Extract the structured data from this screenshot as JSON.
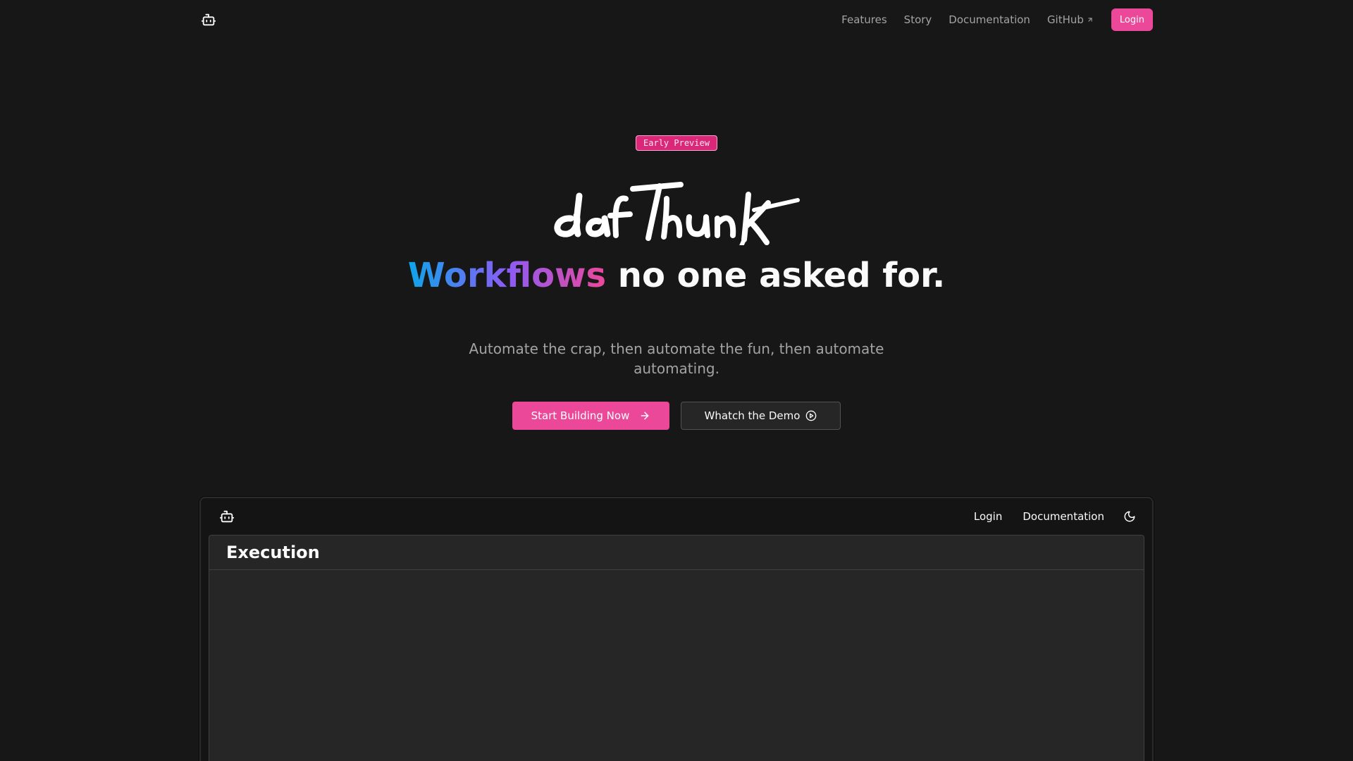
{
  "nav": {
    "logo_icon": "bot-icon",
    "links": [
      "Features",
      "Story",
      "Documentation",
      "GitHub"
    ],
    "github_icon": "arrow-up-right-icon",
    "login_label": "Login"
  },
  "hero": {
    "badge": "Early Preview",
    "logotype": "dafthunk",
    "headline_highlight": "Workflows",
    "headline_rest": " no one asked for.",
    "subline": "Automate the crap, then automate the fun, then automate automating.",
    "primary_cta": "Start Building Now",
    "primary_cta_icon": "arrow-right-icon",
    "secondary_cta": "Whatch the Demo",
    "secondary_cta_icon": "play-circle-icon"
  },
  "preview": {
    "logo_icon": "bot-icon",
    "login_label": "Login",
    "docs_label": "Documentation",
    "theme_icon": "moon-icon",
    "panel_title": "Execution"
  },
  "colors": {
    "background": "#171717",
    "accent": "#ec4899",
    "gradient_start": "#0ea5e9",
    "gradient_mid": "#8b5cf6",
    "gradient_end": "#ec4899"
  }
}
